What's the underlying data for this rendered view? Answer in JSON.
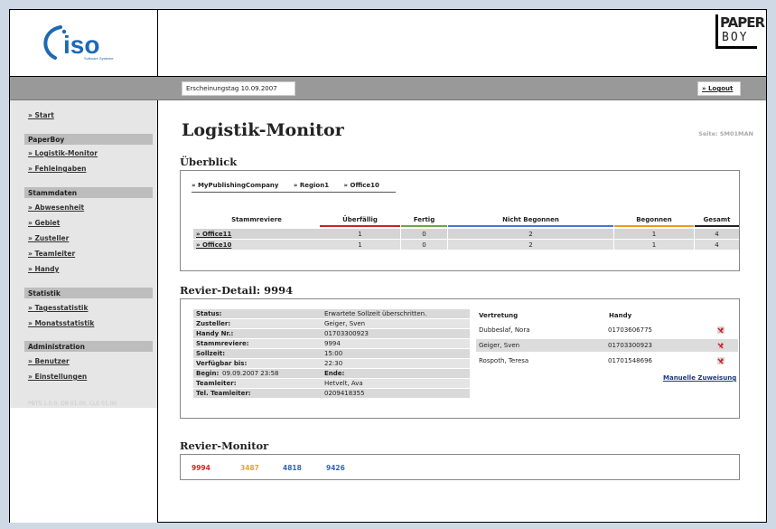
{
  "header": {
    "logo_text": "iso",
    "logo_subtitle": "Software Systeme",
    "brand_line1": "PAPER",
    "brand_line2": "BOY",
    "date_label": "Erscheinungstag 10.09.2007",
    "logout": "» Logout"
  },
  "sidebar": {
    "start": "» Start",
    "sections": [
      {
        "title": "PaperBoy",
        "items": [
          "» Logistik-Monitor",
          "» Fehleingaben"
        ]
      },
      {
        "title": "Stammdaten",
        "items": [
          "» Abwesenheit",
          "» Gebiet",
          "» Zusteller",
          "» Teamleiter",
          "» Handy"
        ]
      },
      {
        "title": "Statistik",
        "items": [
          "» Tagesstatistik",
          "» Monatsstatistik"
        ]
      },
      {
        "title": "Administration",
        "items": [
          "» Benutzer",
          "» Einstellungen"
        ]
      }
    ],
    "version": "PBTS 1.0.0, DB 01.00, CLE 01.00"
  },
  "main": {
    "title": "Logistik-Monitor",
    "seite": "Seite: SM01MAN"
  },
  "overview": {
    "title": "Überblick",
    "breadcrumb": [
      "» MyPublishingCompany",
      "» Region1",
      "» Office10"
    ],
    "headers": [
      "Stammreviere",
      "Überfällig",
      "Fertig",
      "Nicht Begonnen",
      "Begonnen",
      "Gesamt"
    ],
    "header_colors": [
      "#ffffff",
      "#cc2222",
      "#66aa44",
      "#4477cc",
      "#ee9922",
      "#222222"
    ],
    "rows": [
      [
        "» Office11",
        "1",
        "0",
        "2",
        "1",
        "4"
      ],
      [
        "» Office10",
        "1",
        "0",
        "2",
        "1",
        "4"
      ]
    ]
  },
  "detail": {
    "title": "Revier-Detail: 9994",
    "fields": [
      {
        "k": "Status:",
        "v": "Erwartete Sollzeit überschritten."
      },
      {
        "k": "Zusteller:",
        "v": "Geiger, Sven"
      },
      {
        "k": "Handy Nr.:",
        "v": "01703300923"
      },
      {
        "k": "Stammreviere:",
        "v": "9994"
      },
      {
        "k": "Sollzeit:",
        "v": "15:00"
      },
      {
        "k": "Verfügbar bis:",
        "v": "22:30"
      },
      {
        "k": "Begin:",
        "v": "Ende:"
      },
      {
        "k": "Teamleiter:",
        "v": "Hetvelt, Ava"
      },
      {
        "k": "Tel. Teamleiter:",
        "v": "0209418355"
      }
    ],
    "begin_value": "09.09.2007 23:58",
    "vertretung_header": "Vertretung",
    "handy_header": "Handy",
    "vertretung": [
      {
        "name": "Dubbeslaf, Nora",
        "phone": "01703606775"
      },
      {
        "name": "Geiger, Sven",
        "phone": "01703300923"
      },
      {
        "name": "Rospoth, Teresa",
        "phone": "01701548696"
      }
    ],
    "manuelle": "Manuelle Zuweisung"
  },
  "monitor": {
    "title": "Revier-Monitor",
    "items": [
      {
        "label": "9994",
        "color": "#dd2222"
      },
      {
        "label": "3487",
        "color": "#f0a030"
      },
      {
        "label": "4818",
        "color": "#3366bb"
      },
      {
        "label": "9426",
        "color": "#3366bb"
      }
    ]
  },
  "colors": {
    "accent_blue": "#1a3c7a",
    "bar_grey": "#999999"
  }
}
